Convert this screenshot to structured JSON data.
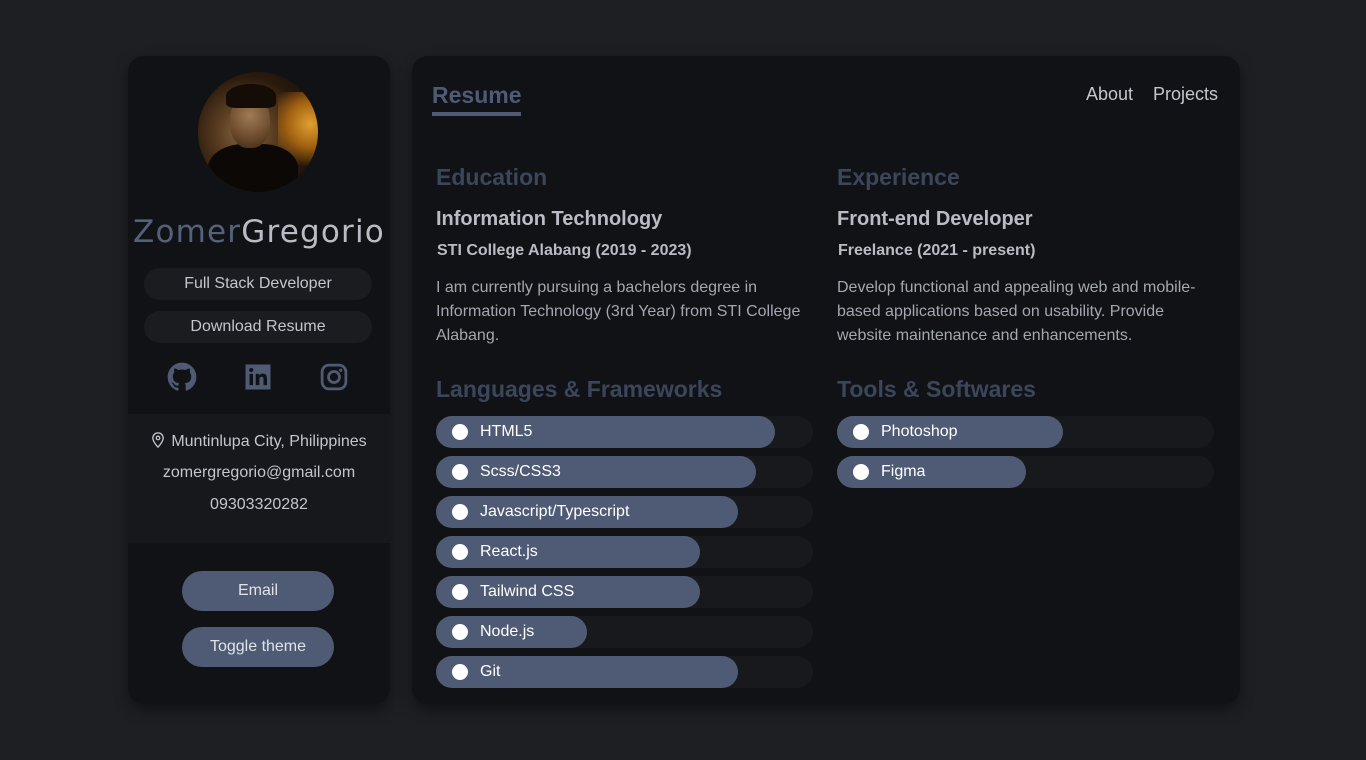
{
  "profile": {
    "first_name": "Zomer",
    "last_name": "Gregorio",
    "role": "Full Stack Developer",
    "download_label": "Download Resume",
    "socials": [
      "github-icon",
      "linkedin-icon",
      "instagram-icon"
    ],
    "location": "Muntinlupa City, Philippines",
    "email": "zomergregorio@gmail.com",
    "phone": "09303320282",
    "email_button": "Email",
    "theme_button": "Toggle theme"
  },
  "nav": {
    "title": "Resume",
    "links": [
      "About",
      "Projects"
    ]
  },
  "education": {
    "heading": "Education",
    "title": "Information Technology",
    "sub": "STI College Alabang (2019 - 2023)",
    "desc": "I am currently pursuing a bachelors degree in Information Technology (3rd Year) from STI College Alabang."
  },
  "experience": {
    "heading": "Experience",
    "title": "Front-end Developer",
    "sub": "Freelance (2021 - present)",
    "desc": "Develop functional and appealing web and mobile-based applications based on usability. Provide website maintenance and enhancements."
  },
  "languages": {
    "heading": "Languages & Frameworks",
    "items": [
      {
        "label": "HTML5",
        "level": 0.9
      },
      {
        "label": "Scss/CSS3",
        "level": 0.85
      },
      {
        "label": "Javascript/Typescript",
        "level": 0.8
      },
      {
        "label": "React.js",
        "level": 0.7
      },
      {
        "label": "Tailwind CSS",
        "level": 0.7
      },
      {
        "label": "Node.js",
        "level": 0.4
      },
      {
        "label": "Git",
        "level": 0.8
      }
    ]
  },
  "tools": {
    "heading": "Tools & Softwares",
    "items": [
      {
        "label": "Photoshop",
        "level": 0.6
      },
      {
        "label": "Figma",
        "level": 0.5
      }
    ]
  },
  "colors": {
    "accent": "#4f5b74",
    "background": "#1e1f23",
    "card": "#111216"
  }
}
